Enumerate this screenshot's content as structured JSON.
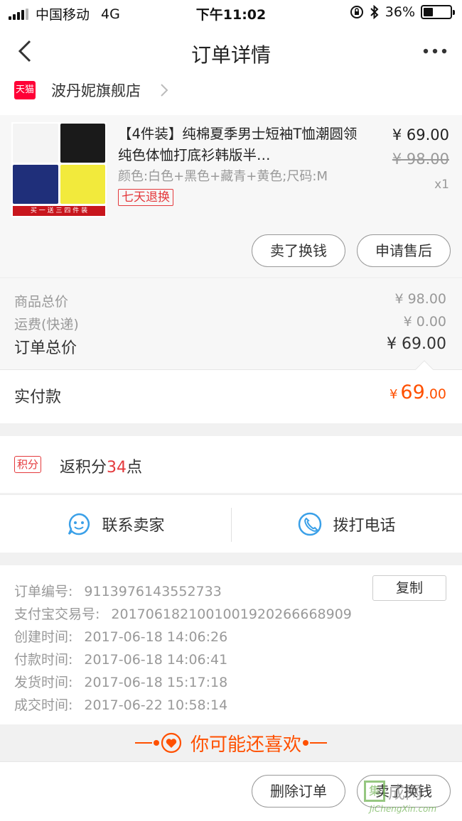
{
  "status_bar": {
    "carrier": "中国移动",
    "network": "4G",
    "time": "下午11:02",
    "battery": "36%",
    "battery_level": 0.36
  },
  "nav": {
    "title": "订单详情"
  },
  "shop": {
    "logo_text": "天猫",
    "name": "波丹妮旗舰店"
  },
  "product": {
    "thumb_banner": "买 一 送 三   四 件 装",
    "title": "【4件装】纯棉夏季男士短袖T恤潮圆领纯色体恤打底衫韩版半…",
    "spec": "颜色:白色+黑色+藏青+黄色;尺码:M",
    "tag": "七天退换",
    "price": "¥ 69.00",
    "original_price": "¥ 98.00",
    "quantity": "x1",
    "sell_button": "卖了换钱",
    "aftersale_button": "申请售后",
    "shirt_colors": [
      "#f4f4f4",
      "#1a1a1a",
      "#1f2f7a",
      "#f2ea3c"
    ]
  },
  "summary": {
    "goods_total_label": "商品总价",
    "goods_total": "¥ 98.00",
    "shipping_label": "运费(快递)",
    "shipping": "¥ 0.00",
    "order_total_label": "订单总价",
    "order_total": "¥ 69.00",
    "paid_label": "实付款",
    "paid_currency": "¥",
    "paid_int": "69",
    "paid_dec": ".00"
  },
  "points": {
    "tag": "积分",
    "prefix": "返积分",
    "value": "34",
    "suffix": "点"
  },
  "contact": {
    "seller": "联系卖家",
    "phone": "拨打电话"
  },
  "order_info": {
    "copy_button": "复制",
    "rows": [
      {
        "label": "订单编号:",
        "value": "9113976143552733"
      },
      {
        "label": "支付宝交易号:",
        "value": "2017061821001001920266668909"
      },
      {
        "label": "创建时间:",
        "value": "2017-06-18 14:06:26"
      },
      {
        "label": "付款时间:",
        "value": "2017-06-18 14:06:41"
      },
      {
        "label": "发货时间:",
        "value": "2017-06-18 15:17:18"
      },
      {
        "label": "成交时间:",
        "value": "2017-06-22 10:58:14"
      }
    ]
  },
  "like": {
    "title": "你可能还喜欢"
  },
  "bottom": {
    "delete_button": "删除订单",
    "sell_button": "卖了换钱"
  },
  "watermark": {
    "box": "集",
    "cn": "成网",
    "en": "JiChengXin.com"
  },
  "colors": {
    "accent": "#ff5000",
    "tmall_red": "#ff0036",
    "tag_red": "#e4393c",
    "icon_blue": "#3aa0e8"
  }
}
